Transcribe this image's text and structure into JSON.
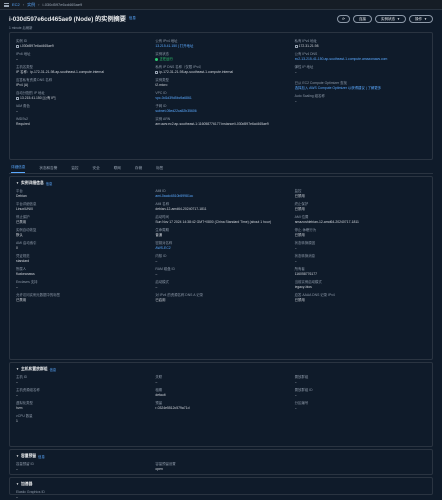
{
  "breadcrumb": {
    "home": "EC2",
    "section": "实例",
    "current": "i-030d597e6cd465ae9"
  },
  "header": {
    "title": "i-030d597e6cd465ae9 (Node) 的实例摘要",
    "info": "信息",
    "subtitle": "1 minute 后刷新",
    "actions": {
      "connect": "连接",
      "state": "实例状态",
      "actions": "操作"
    }
  },
  "summary": {
    "col1": [
      {
        "label": "实例 ID",
        "value": "i-030d597e6cd465ae9",
        "style": "icon"
      },
      {
        "label": "IPv6 地址",
        "value": "–"
      },
      {
        "label": "主机名类型",
        "value": "IP 名称：ip-172-31-21-98.ap-southeast-1.compute.internal"
      },
      {
        "label": "应答私有资源 DNS 名称",
        "value": "IPv4 (A)"
      },
      {
        "label": "自动分配的 IP 地址",
        "value": "13.215.41.150 [公有 IP]",
        "style": "icon"
      },
      {
        "label": "IAM 角色",
        "value": "–"
      },
      {
        "label": "IMDSv2",
        "value": "Required"
      }
    ],
    "col2": [
      {
        "label": "公有 IPv4 地址",
        "value": "13.215.41.150 | 打开地址",
        "style": "link"
      },
      {
        "label": "实例状态",
        "value": "正在运行",
        "style": "green"
      },
      {
        "label": "私有 IP DNS 名称（仅限 IPv4）",
        "value": "ip-172-31-21-98.ap-southeast-1.compute.internal",
        "style": "icon"
      },
      {
        "label": "实例类型",
        "value": "t2.micro"
      },
      {
        "label": "VPC ID",
        "value": "vpc-0d1d39d5bc9a6861",
        "style": "link"
      },
      {
        "label": "子网 ID",
        "value": "subnet-05ed22ca52b35606",
        "style": "link"
      },
      {
        "label": "实例 ARN",
        "value": "arn:aws:ec2:ap-southeast-1:116058776177:instance/i-030d597e6cd465ae9"
      }
    ],
    "col3": [
      {
        "label": "私有 IPv4 地址",
        "value": "172.31.21.98",
        "style": "icon"
      },
      {
        "label": "公有 IPv4 DNS",
        "value": "ec2-13-215-41-150.ap-southeast-1.compute.amazonaws.com",
        "style": "link"
      },
      {
        "label": "弹性 IP 地址",
        "value": "–"
      },
      {
        "label": "",
        "value": ""
      },
      {
        "label": "已从 EC2 Compute Optimizer 查找",
        "value": "选择加入 AWS Compute Optimizer 以获得建议 | 了解更多",
        "style": "link"
      },
      {
        "label": "Auto Scaling 组名称",
        "value": "–"
      },
      {
        "label": "",
        "value": ""
      }
    ]
  },
  "tabs": [
    "详细信息",
    "状态和告警",
    "监控",
    "安全",
    "联网",
    "存储",
    "标签"
  ],
  "details": {
    "title": "实例详细信息",
    "info": "信息",
    "rows": [
      [
        {
          "label": "平台",
          "value": "Debian"
        },
        {
          "label": "AMI ID",
          "value": "ami-0acdc6510b59981cc",
          "style": "link"
        },
        {
          "label": "监控",
          "value": "已禁用"
        }
      ],
      [
        {
          "label": "平台详细信息",
          "value": "Linux/UNIX"
        },
        {
          "label": "AMI 名称",
          "value": "debian-12-amd64-20240717-1811"
        },
        {
          "label": "终止保护",
          "value": "已禁用"
        }
      ],
      [
        {
          "label": "停止保护",
          "value": "已禁用"
        },
        {
          "label": "启动时间",
          "value": "Sun Nov 17 2024 14:38:42 GMT+0800 (China Standard Time) (about 1 hour)"
        },
        {
          "label": "AMI 位置",
          "value": "amazon/debian-12-amd64-20240717-1811"
        }
      ],
      [
        {
          "label": "实例自动恢复",
          "value": "默认"
        },
        {
          "label": "生命周期",
          "value": "普通"
        },
        {
          "label": "停止-休眠行为",
          "value": "已禁用"
        }
      ],
      [
        {
          "label": "AMI 启动索引",
          "value": "0"
        },
        {
          "label": "密钥对名称",
          "value": "AWS-EC2",
          "style": "link"
        },
        {
          "label": "状态转换原因",
          "value": "–"
        }
      ],
      [
        {
          "label": "凭证规范",
          "value": "standard"
        },
        {
          "label": "内核 ID",
          "value": "–"
        },
        {
          "label": "状态转换消息",
          "value": "–"
        }
      ],
      [
        {
          "label": "所属人",
          "value": "fluxkeanaws"
        },
        {
          "label": "RAM 磁盘 ID",
          "value": "–"
        },
        {
          "label": "所有者",
          "value": "116058776177"
        }
      ],
      [
        {
          "label": "Enclaves 支持",
          "value": "–"
        },
        {
          "label": "启动模式",
          "value": "–"
        },
        {
          "label": "当前实例启动模式",
          "value": "legacy-bios"
        }
      ],
      [
        {
          "label": "允许访问实例元数据中的标签",
          "value": "已禁用"
        },
        {
          "label": "对 IPv4 的资源名称 DNS A 记录",
          "value": "已启用"
        },
        {
          "label": "应答 AAAA DNS 记录 IPv4",
          "value": "已禁用"
        }
      ]
    ]
  },
  "host": {
    "title": "主机和置放群组",
    "info": "信息",
    "rows": [
      [
        {
          "label": "主机 ID",
          "value": "–"
        },
        {
          "label": "关联",
          "value": "–"
        },
        {
          "label": "置放群组",
          "value": "–"
        }
      ],
      [
        {
          "label": "主机资源组名称",
          "value": "–"
        },
        {
          "label": "租期",
          "value": "default"
        },
        {
          "label": "置放群组 ID",
          "value": "–"
        }
      ],
      [
        {
          "label": "虚拟化类型",
          "value": "hvm"
        },
        {
          "label": "预留",
          "value": "r-0324e5512c579a71d"
        },
        {
          "label": "分区编号",
          "value": "–"
        }
      ],
      [
        {
          "label": "vCPU 数量",
          "value": "1"
        },
        {
          "label": "",
          "value": ""
        },
        {
          "label": "",
          "value": ""
        }
      ]
    ]
  },
  "capacity": {
    "title": "容量预留",
    "info": "信息",
    "rows": [
      [
        {
          "label": "容量预留 ID",
          "value": "–"
        },
        {
          "label": "容量预留设置",
          "value": "open"
        },
        {
          "label": "",
          "value": ""
        }
      ]
    ]
  },
  "accelerators": {
    "title": "加速器",
    "rows": [
      [
        {
          "label": "Elastic Graphics ID",
          "value": "–"
        },
        {
          "label": "",
          "value": ""
        },
        {
          "label": "",
          "value": ""
        }
      ]
    ]
  }
}
